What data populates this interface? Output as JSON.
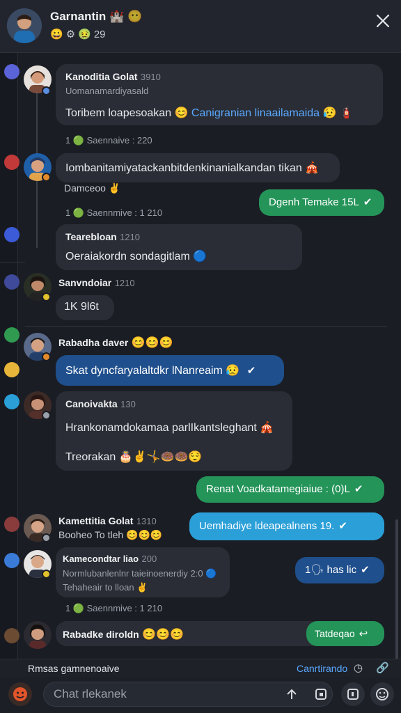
{
  "header": {
    "title": "Garnantin",
    "title_emoji": "🏰",
    "status_emoji": "😶",
    "sub_icons": [
      "😀",
      "⚙",
      "🤢"
    ],
    "sub_count": "29",
    "close_icon": "close-icon"
  },
  "messages": [
    {
      "name": "Kanoditia Golat",
      "time": "3910",
      "meta": "Uomanamardiyasald",
      "text": "Toribem loapesoakan",
      "emoji1": "😊",
      "link": "Canigranian linaailamaida",
      "emoji2": "😥",
      "emoji3": "🧯"
    },
    {
      "sys": "1 🟢 Saennaive : 220"
    },
    {
      "text": "Iombanitamiyatackanbitdenkinanialkandan tikan",
      "emoji": "🎪",
      "sub": "Damceoo",
      "sub_emoji": "✌"
    },
    {
      "right_green": "Dgenh Temake 15L",
      "check": "✔"
    },
    {
      "sys": "1 🟢 Saennmive : 1 210"
    },
    {
      "name": "Tearebloan",
      "time": "1210",
      "text": "Oeraiakordn sondagitlam",
      "emoji": "🔵"
    },
    {
      "name": "Sanvndoiar",
      "time": "1210",
      "text": "1K 9l6t"
    },
    {
      "name": "Rabadha daver",
      "emojis": [
        "😊",
        "😊",
        "😊"
      ],
      "text": "Skat dyncfaryalaltdkr lNanreaim",
      "emoji": "😥",
      "check": "✔"
    },
    {
      "name": "Canoivakta",
      "time": "130",
      "text1": "Hrankonamdokamaa parlIkantsleghant",
      "emoji1": "🎪",
      "text2": "Treorakan",
      "emojis": [
        "🎂",
        "✌",
        "🤸",
        "🍩",
        "🍩",
        "😌"
      ]
    },
    {
      "right_green": "Renat Voadkatamegiaiue : (0)L",
      "check": "✔"
    },
    {
      "name": "Kamettitia Golat",
      "time": "1310",
      "sub": "Booheo To tleh",
      "emojis": [
        "😊",
        "😊",
        "😊"
      ],
      "right_cyan": "Uemhadiye ldeapealnens 19.",
      "check": "✔"
    },
    {
      "name": "Kamecondtar liao",
      "time": "200",
      "line2": "Normlubanlenlnr taieinoenerdiy 2:0",
      "line2_emoji": "🔵",
      "line3": "Tehaheair to lloan",
      "line3_emoji": "✌",
      "right_blue": "1🗣 has lic",
      "check": "✔"
    },
    {
      "sys": "1 🟢 Saennmive : 1 210"
    },
    {
      "name": "Rabadke diroldn",
      "emojis": [
        "😊",
        "😊",
        "😊"
      ],
      "right_green": "Tatdeqao",
      "check": "↩"
    }
  ],
  "composer": {
    "top_label": "Rmsas gamnenoaive",
    "top_right": "Canrtirando",
    "top_icons": [
      "clock-icon",
      "link-icon"
    ],
    "placeholder": "Chat rlekanek",
    "left_button": "emoji-button",
    "right_buttons": [
      "attach-icon",
      "image-icon",
      "gif-icon",
      "sticker-icon"
    ]
  },
  "colors": {
    "bg": "#1a1d24",
    "bubble_dark": "#2a2d35",
    "green": "#249459",
    "blue": "#1f4f8c",
    "cyan": "#2a9fd8",
    "link": "#5aa8ff"
  }
}
